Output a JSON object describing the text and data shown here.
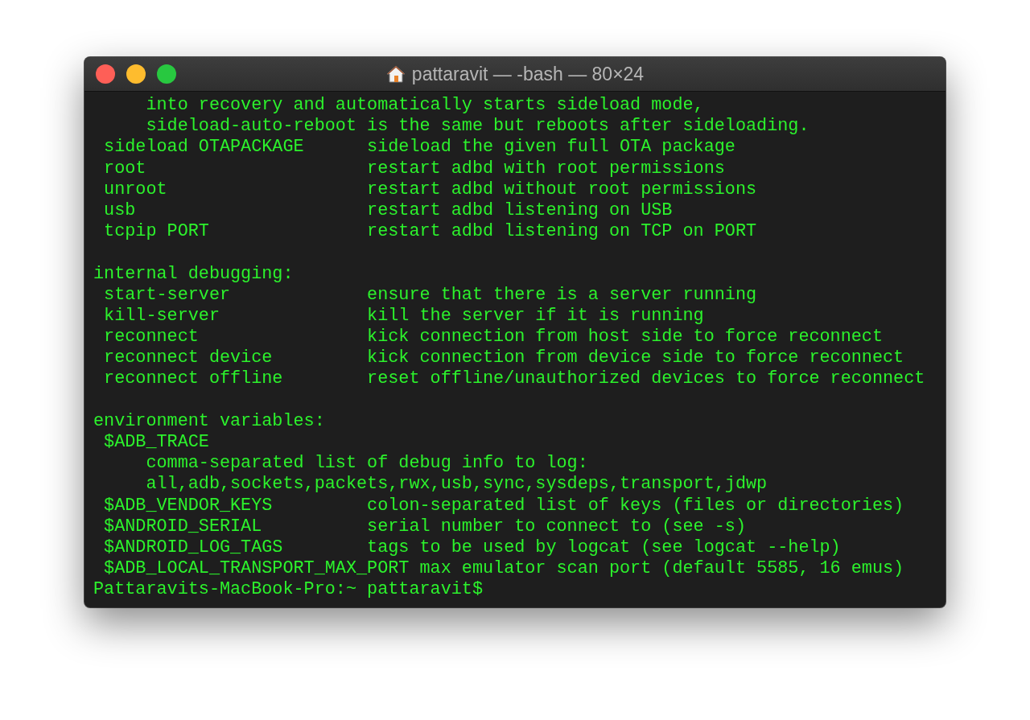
{
  "window": {
    "title": "pattaravit — -bash — 80×24"
  },
  "terminal": {
    "lines": [
      {
        "kind": "text",
        "text": "     into recovery and automatically starts sideload mode,"
      },
      {
        "kind": "text",
        "text": "     sideload-auto-reboot is the same but reboots after sideloading."
      },
      {
        "kind": "text",
        "text": " sideload OTAPACKAGE      sideload the given full OTA package"
      },
      {
        "kind": "text",
        "text": " root                     restart adbd with root permissions"
      },
      {
        "kind": "text",
        "text": " unroot                   restart adbd without root permissions"
      },
      {
        "kind": "text",
        "text": " usb                      restart adbd listening on USB"
      },
      {
        "kind": "text",
        "text": " tcpip PORT               restart adbd listening on TCP on PORT"
      },
      {
        "kind": "blank"
      },
      {
        "kind": "text",
        "text": "internal debugging:"
      },
      {
        "kind": "text",
        "text": " start-server             ensure that there is a server running"
      },
      {
        "kind": "text",
        "text": " kill-server              kill the server if it is running"
      },
      {
        "kind": "text",
        "text": " reconnect                kick connection from host side to force reconnect"
      },
      {
        "kind": "text",
        "text": " reconnect device         kick connection from device side to force reconnect"
      },
      {
        "kind": "text",
        "text": " reconnect offline        reset offline/unauthorized devices to force reconnect"
      },
      {
        "kind": "blank"
      },
      {
        "kind": "text",
        "text": "environment variables:"
      },
      {
        "kind": "text",
        "text": " $ADB_TRACE"
      },
      {
        "kind": "text",
        "text": "     comma-separated list of debug info to log:"
      },
      {
        "kind": "text",
        "text": "     all,adb,sockets,packets,rwx,usb,sync,sysdeps,transport,jdwp"
      },
      {
        "kind": "text",
        "text": " $ADB_VENDOR_KEYS         colon-separated list of keys (files or directories)"
      },
      {
        "kind": "text",
        "text": " $ANDROID_SERIAL          serial number to connect to (see -s)"
      },
      {
        "kind": "text",
        "text": " $ANDROID_LOG_TAGS        tags to be used by logcat (see logcat --help)"
      },
      {
        "kind": "text",
        "text": " $ADB_LOCAL_TRANSPORT_MAX_PORT max emulator scan port (default 5585, 16 emus)"
      },
      {
        "kind": "prompt",
        "text": "Pattaravits-MacBook-Pro:~ pattaravit$"
      }
    ]
  }
}
